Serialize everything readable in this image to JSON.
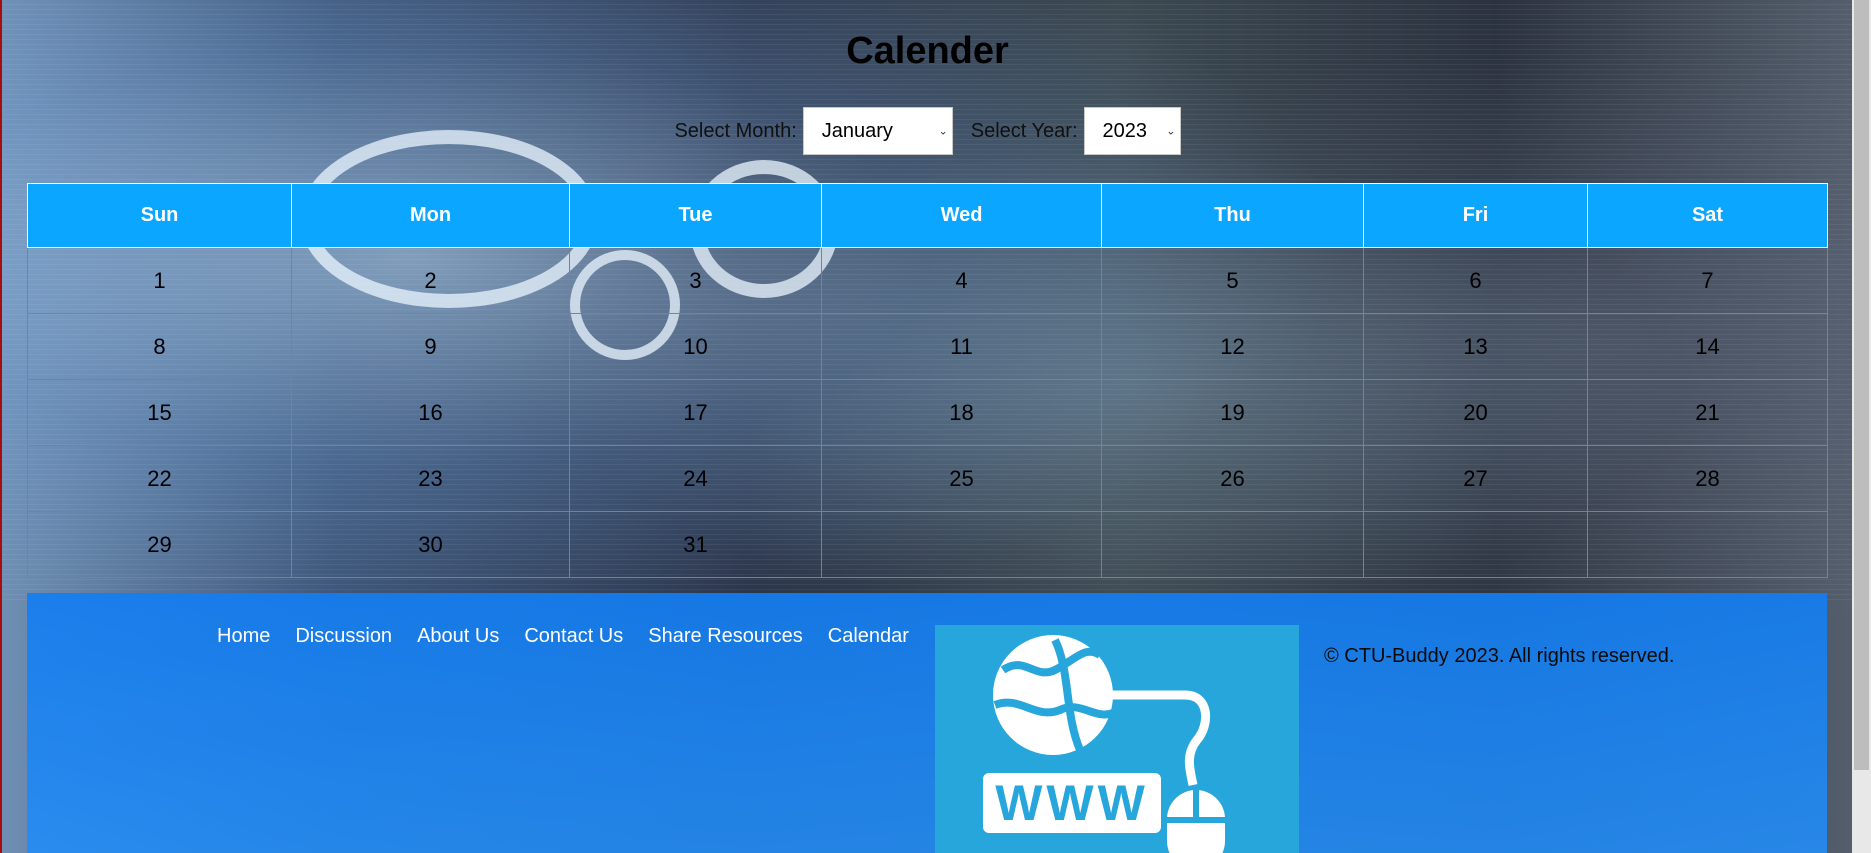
{
  "page": {
    "title": "Calender"
  },
  "controls": {
    "month_label": "Select Month:",
    "month_value": "January",
    "year_label": "Select Year:",
    "year_value": "2023"
  },
  "calendar": {
    "headers": [
      "Sun",
      "Mon",
      "Tue",
      "Wed",
      "Thu",
      "Fri",
      "Sat"
    ],
    "weeks": [
      [
        "1",
        "2",
        "3",
        "4",
        "5",
        "6",
        "7"
      ],
      [
        "8",
        "9",
        "10",
        "11",
        "12",
        "13",
        "14"
      ],
      [
        "15",
        "16",
        "17",
        "18",
        "19",
        "20",
        "21"
      ],
      [
        "22",
        "23",
        "24",
        "25",
        "26",
        "27",
        "28"
      ],
      [
        "29",
        "30",
        "31",
        "",
        "",
        "",
        ""
      ]
    ]
  },
  "footer": {
    "nav": [
      "Home",
      "Discussion",
      "About Us",
      "Contact Us",
      "Share Resources",
      "Calendar"
    ],
    "logo_text": "WWW",
    "copyright": "© CTU-Buddy 2023. All rights reserved."
  },
  "colors": {
    "header_bg": "#0ba6ff",
    "footer_bg": "#1e86f0",
    "logo_bg": "#27a6dc"
  },
  "icons": {
    "month_caret": "chevron-down-icon",
    "year_caret": "chevron-down-icon",
    "logo": "globe-www-mouse-icon"
  }
}
